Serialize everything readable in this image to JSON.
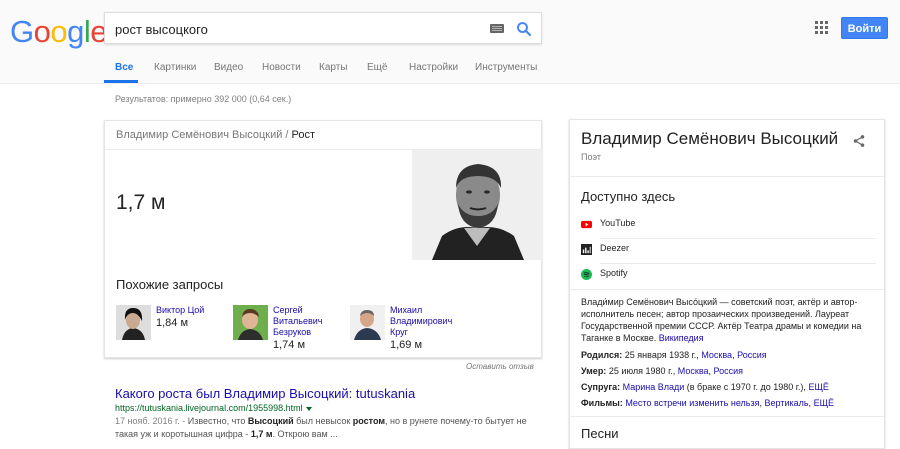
{
  "logo": {
    "letters": [
      "G",
      "o",
      "o",
      "g",
      "l",
      "e"
    ]
  },
  "search": {
    "query": "рост высоцкого"
  },
  "header": {
    "signin_label": "Войти"
  },
  "tabs": [
    {
      "label": "Все",
      "active": true
    },
    {
      "label": "Картинки"
    },
    {
      "label": "Видео"
    },
    {
      "label": "Новости"
    },
    {
      "label": "Карты"
    },
    {
      "label": "Ещё"
    },
    {
      "label": "Настройки"
    },
    {
      "label": "Инструменты"
    }
  ],
  "results_count": "Результатов: примерно 392 000 (0,64 сек.)",
  "answer": {
    "entity": "Владимир Семёнович Высоцкий",
    "separator": "/",
    "attribute": "Рост",
    "value": "1,7 м",
    "related_title": "Похожие запросы",
    "related": [
      {
        "name": "Виктор Цой",
        "height": "1,84 м"
      },
      {
        "name": "Сергей Витальевич Безруков",
        "height": "1,74 м"
      },
      {
        "name": "Михаил Владимирович Круг",
        "height": "1,69 м"
      }
    ],
    "feedback": "Оставить отзыв"
  },
  "result1": {
    "title": "Какого роста был Владимир Высоцкий: tutuskania",
    "url": "https://tutuskania.livejournal.com/1955998.html",
    "date": "17 нояб. 2016 г. -",
    "snippet_1": " Известно, что ",
    "snippet_b1": "Высоцкий",
    "snippet_2": " был невысок ",
    "snippet_b2": "ростом",
    "snippet_3": ", но в рунете почему-то бытует не такая уж и коротышная цифра - ",
    "snippet_b3": "1,7 м",
    "snippet_4": ". Открою вам ..."
  },
  "knowledge_panel": {
    "title": "Владимир Семёнович Высоцкий",
    "subtitle": "Поэт",
    "available_title": "Доступно здесь",
    "services": [
      {
        "label": "YouTube",
        "icon": "youtube-icon",
        "color": "#ff0000"
      },
      {
        "label": "Deezer",
        "icon": "deezer-icon",
        "color": "#222222"
      },
      {
        "label": "Spotify",
        "icon": "spotify-icon",
        "color": "#1db954"
      }
    ],
    "description": "Влади́мир Семёнович Высо́цкий — советский поэт, актёр и автор-исполнитель песен; автор прозаических произведений. Лауреат Государственной премии СССР. Актёр Театра драмы и комедии на Таганке в Москве.",
    "wiki_link": "Википедия",
    "facts": {
      "born_label": "Родился:",
      "born_value": "25 января 1938 г.,",
      "born_place1": "Москва",
      "born_comma": ",",
      "born_place2": "Россия",
      "died_label": "Умер:",
      "died_value": "25 июля 1980 г.,",
      "died_place1": "Москва",
      "died_comma": ",",
      "died_place2": "Россия",
      "spouse_label": "Супруга:",
      "spouse_link": "Марина Влади",
      "spouse_note": "(в браке с 1970 г. до 1980 г.),",
      "spouse_more": "ЕЩЁ",
      "films_label": "Фильмы:",
      "film1": "Место встречи изменить нельзя",
      "films_comma1": ",",
      "film2": "Вертикаль",
      "films_comma2": ",",
      "films_more": "ЕЩЁ"
    },
    "songs_title": "Песни"
  }
}
